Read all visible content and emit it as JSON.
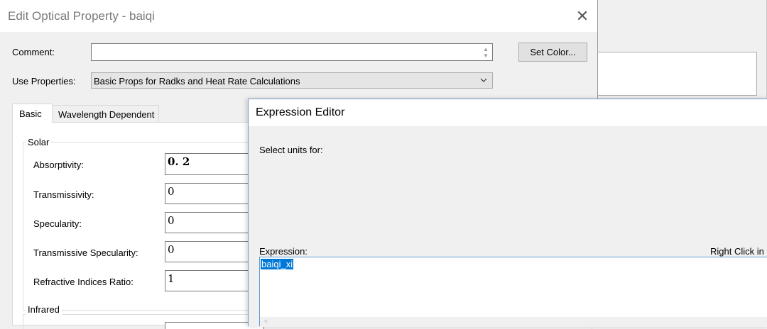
{
  "dialog": {
    "title": "Edit Optical Property - baiqi",
    "close_glyph": "✕",
    "comment_label": "Comment:",
    "comment_value": "",
    "set_color_label": "Set Color...",
    "use_properties_label": "Use Properties:",
    "use_properties_value": "Basic Props for Radks and Heat Rate Calculations",
    "tabs": [
      {
        "label": "Basic",
        "active": true
      },
      {
        "label": "Wavelength Dependent",
        "active": false
      }
    ],
    "solar": {
      "group_label": "Solar",
      "fields": [
        {
          "label": "Absorptivity:",
          "value": "0. 2"
        },
        {
          "label": "Transmissivity:",
          "value": "0"
        },
        {
          "label": "Specularity:",
          "value": "0"
        },
        {
          "label": "Transmissive Specularity:",
          "value": "0"
        },
        {
          "label": "Refractive Indices Ratio:",
          "value": "1"
        }
      ]
    },
    "infrared": {
      "group_label": "Infrared"
    }
  },
  "expression_editor": {
    "title": "Expression Editor",
    "select_units_label": "Select units for:",
    "expression_label": "Expression:",
    "right_hint": "Right Click in e",
    "expression_value": "baiqi_xi",
    "scroll_left_glyph": "<"
  },
  "colors": {
    "selection": "#0078d7",
    "focus_border": "#5b9bd5",
    "title_text_inactive": "#7a7a7a"
  }
}
